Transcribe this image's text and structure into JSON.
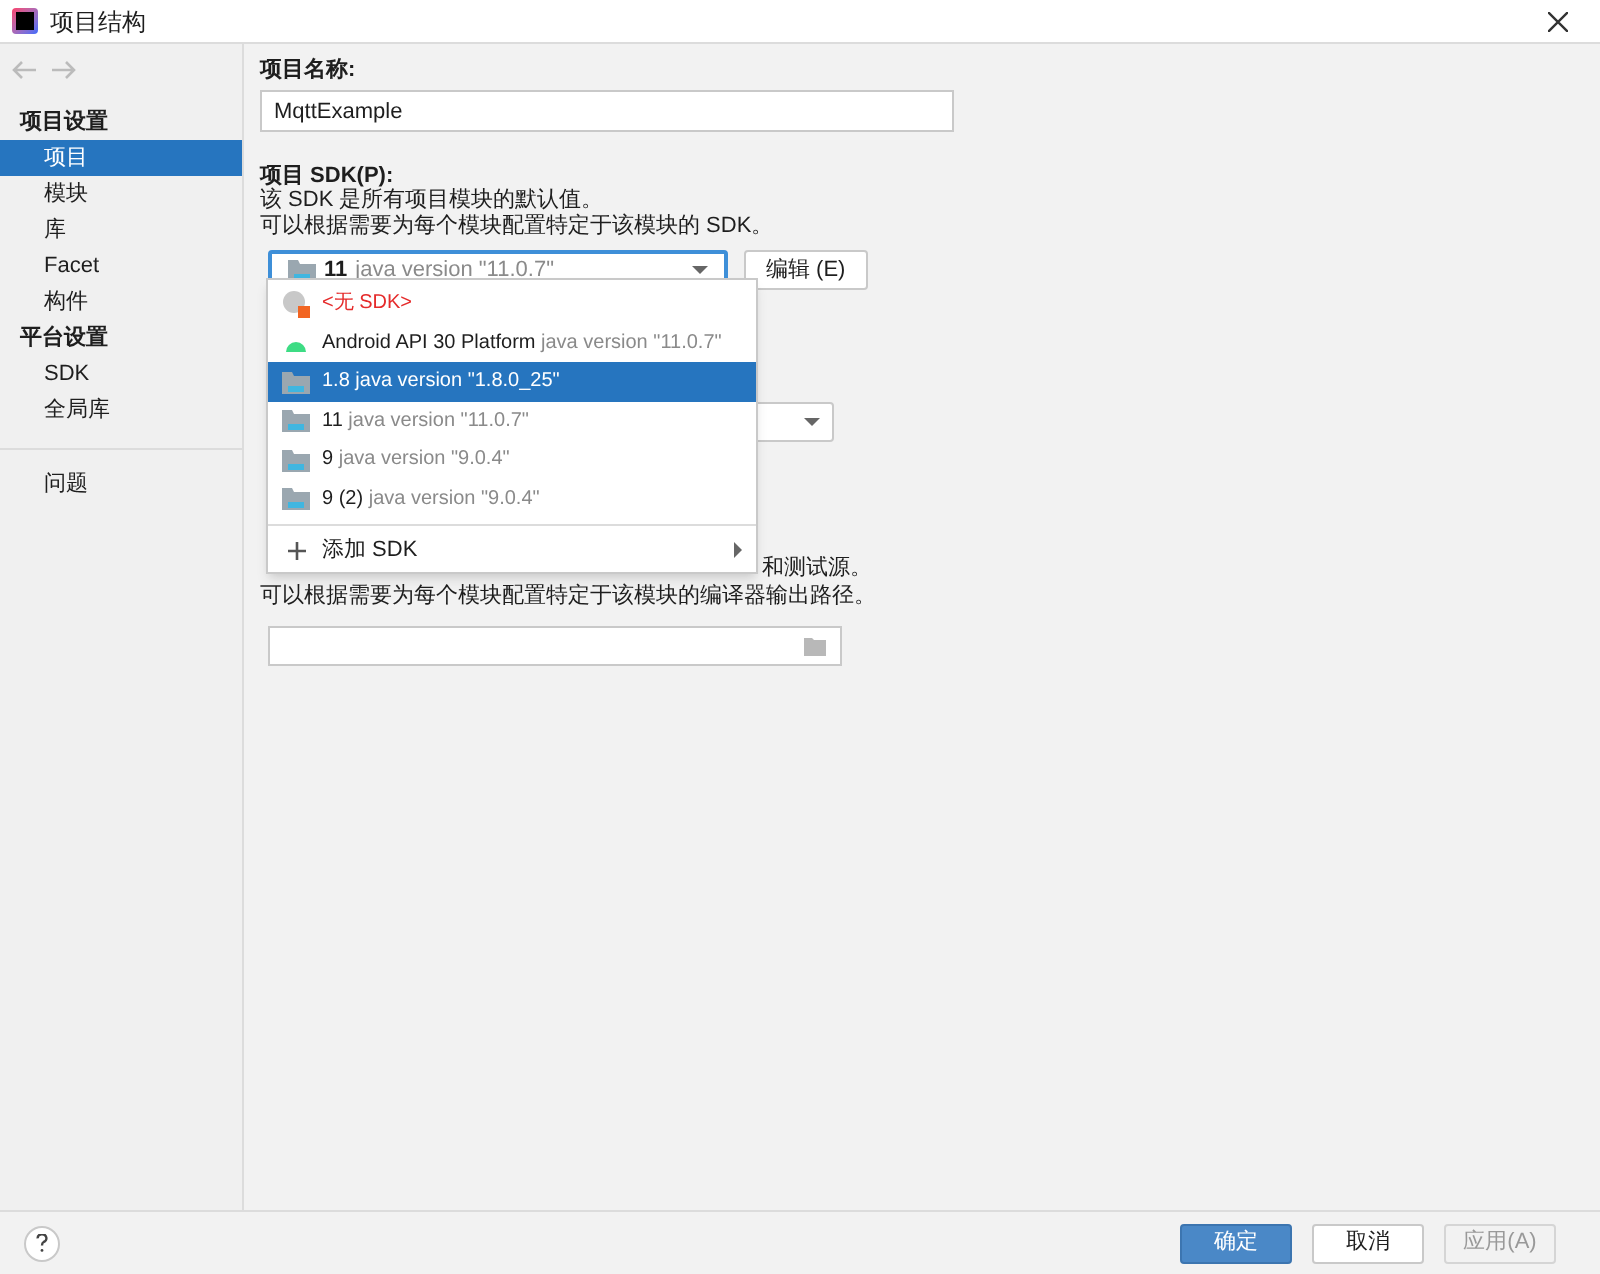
{
  "window": {
    "title": "项目结构"
  },
  "sidebar": {
    "groups": [
      {
        "title": "项目设置",
        "items": [
          {
            "label": "项目",
            "selected": true
          },
          {
            "label": "模块",
            "selected": false
          },
          {
            "label": "库",
            "selected": false
          },
          {
            "label": "Facet",
            "selected": false
          },
          {
            "label": "构件",
            "selected": false
          }
        ]
      },
      {
        "title": "平台设置",
        "items": [
          {
            "label": "SDK",
            "selected": false
          },
          {
            "label": "全局库",
            "selected": false
          }
        ]
      },
      {
        "items": [
          {
            "label": "问题",
            "selected": false
          }
        ]
      }
    ]
  },
  "project_name": {
    "label": "项目名称:",
    "value": "MqttExample"
  },
  "project_sdk": {
    "label": "项目 SDK(P):",
    "lines": [
      "该 SDK 是所有项目模块的默认值。",
      "可以根据需要为每个模块配置特定于该模块的 SDK。"
    ],
    "value_name": "11",
    "value_detail": "java version \"11.0.7\"",
    "edit_button": "编辑 (E)"
  },
  "sdk_menu": {
    "items": [
      {
        "kind": "none",
        "name": "<无 SDK>",
        "selected": false
      },
      {
        "kind": "android",
        "name": "Android API 30 Platform",
        "detail": "java version \"11.0.7\"",
        "selected": false
      },
      {
        "kind": "jdk",
        "name": "1.8",
        "detail": "java version \"1.8.0_25\"",
        "selected": true
      },
      {
        "kind": "jdk",
        "name": "11",
        "detail": "java version \"11.0.7\"",
        "selected": false
      },
      {
        "kind": "jdk",
        "name": "9",
        "detail": "java version \"9.0.4\"",
        "selected": false
      },
      {
        "kind": "jdk",
        "name": "9 (2)",
        "detail": "java version \"9.0.4\"",
        "selected": false
      }
    ],
    "add_item": "添加 SDK"
  },
  "compiler_output": {
    "partial_line_end": "和测试源。",
    "last_line": "可以根据需要为每个模块配置特定于该模块的编译器输出路径。"
  },
  "buttons": {
    "ok": "确定",
    "cancel": "取消",
    "apply": "应用(A)"
  }
}
